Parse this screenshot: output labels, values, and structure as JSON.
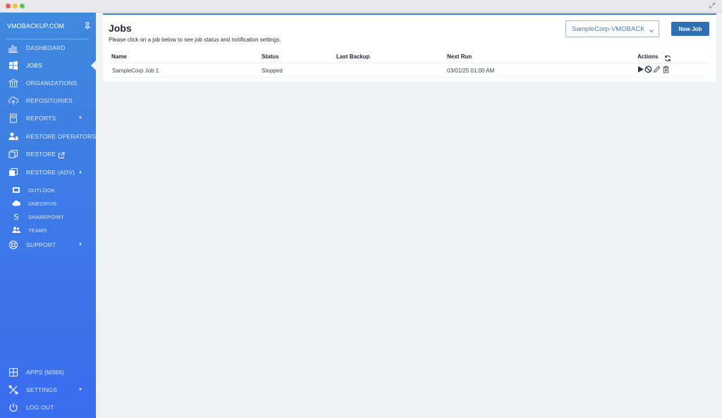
{
  "sidebar": {
    "brand": "VMOBACKUP.COM",
    "items": [
      {
        "label": "DASHBOARD"
      },
      {
        "label": "JOBS"
      },
      {
        "label": "ORGANIZATIONS"
      },
      {
        "label": "REPOSITORIES"
      },
      {
        "label": "REPORTS"
      },
      {
        "label": "RESTORE OPERATORS"
      },
      {
        "label": "RESTORE"
      },
      {
        "label": "RESTORE (ADV)"
      },
      {
        "label": "SUPPORT"
      }
    ],
    "restore_adv_sub": [
      {
        "label": "OUTLOOK"
      },
      {
        "label": "ONEDRIVE"
      },
      {
        "label": "SHAREPOINT"
      },
      {
        "label": "TEAMS"
      }
    ],
    "bottom": [
      {
        "label": "APPS (M365)"
      },
      {
        "label": "SETTINGS"
      },
      {
        "label": "LOG OUT"
      }
    ],
    "active": "JOBS"
  },
  "main": {
    "title": "Jobs",
    "subtitle": "Please click on a job below to see job status and notification settings.",
    "org_select": {
      "value": "SampleCorp-VMOBACKUP"
    },
    "new_job_label": "New Job",
    "table": {
      "headers": {
        "name": "Name",
        "status": "Status",
        "last_backup": "Last Backup",
        "next_run": "Next Run",
        "actions": "Actions"
      },
      "rows": [
        {
          "name": "SampleCorp Job 1",
          "status": "Stopped",
          "last_backup": "",
          "next_run": "03/01/25 01:00 AM"
        }
      ]
    }
  },
  "colors": {
    "sidebar_top": "#3f88df",
    "sidebar_bottom": "#3a6cf0",
    "button_primary": "#2f6fb3",
    "panel_accent": "#3f7fd6"
  },
  "icons": {
    "row_actions": [
      "play-icon",
      "stop-icon",
      "edit-icon",
      "delete-icon"
    ]
  }
}
